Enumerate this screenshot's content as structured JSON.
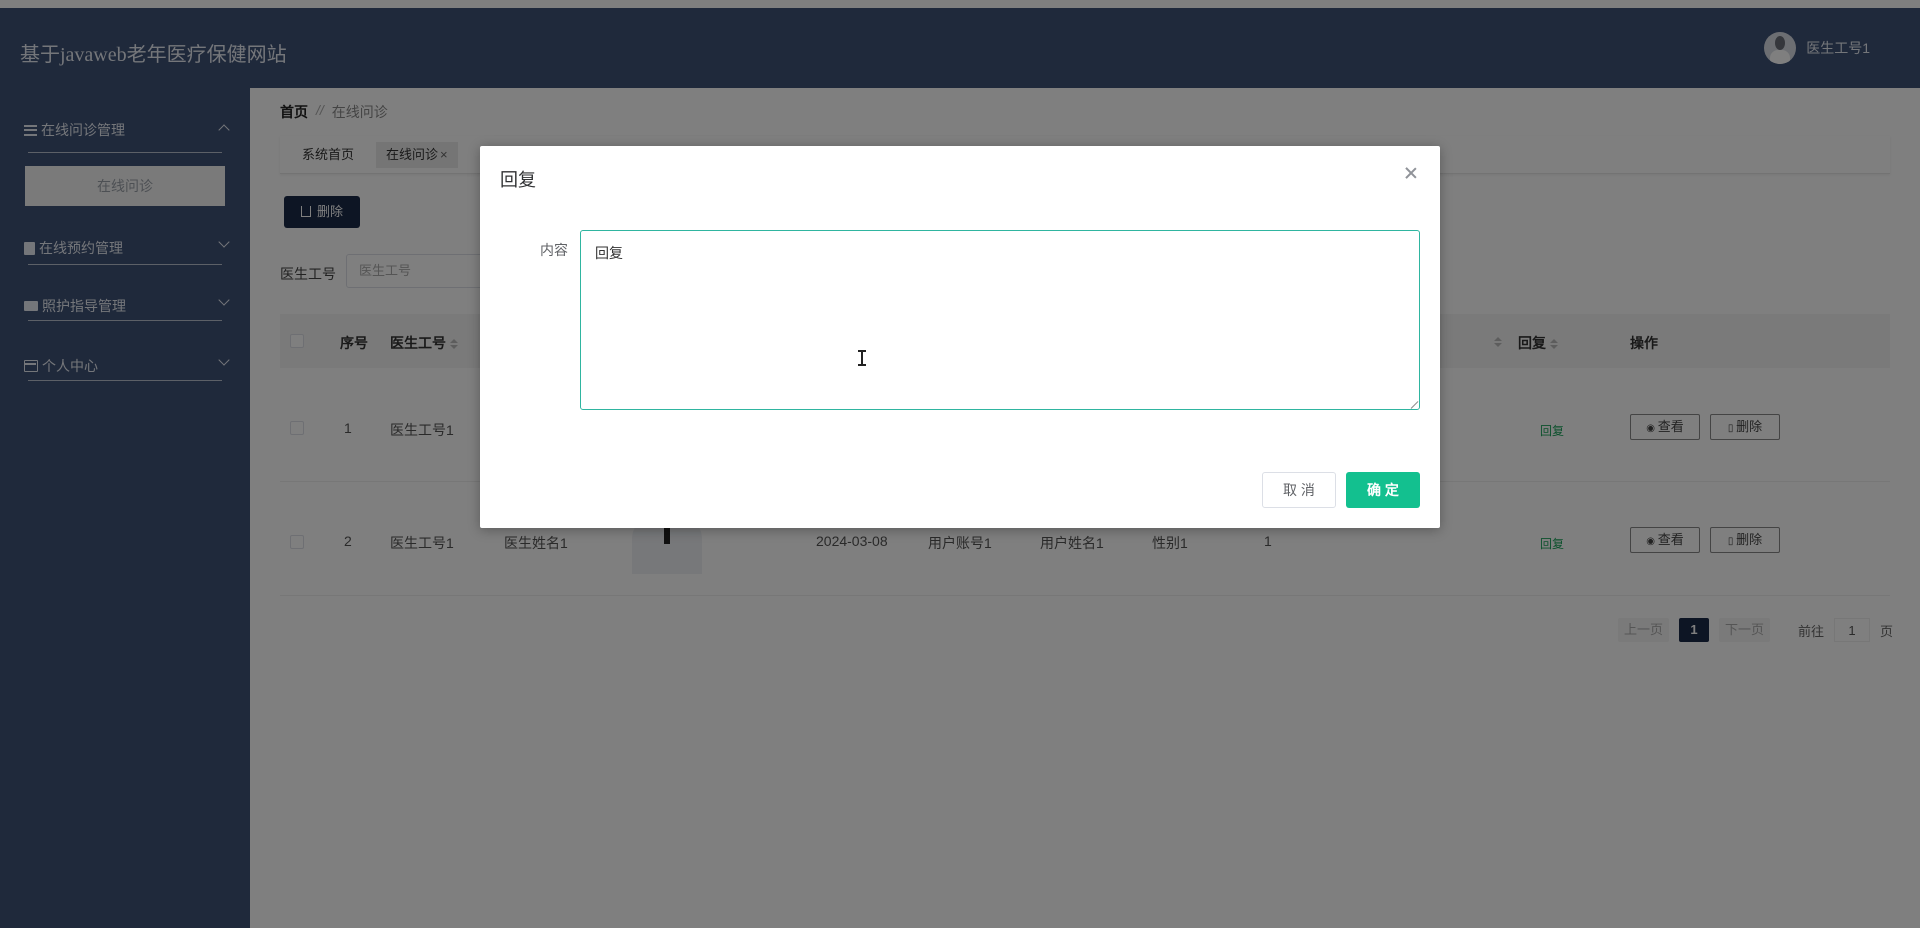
{
  "header": {
    "site_title": "基于javaweb老年医疗保健网站",
    "user_name": "医生工号1"
  },
  "sidebar": {
    "groups": [
      {
        "label": "在线问诊管理",
        "icon": "list-icon",
        "expanded": true,
        "items": [
          {
            "label": "在线问诊"
          }
        ]
      },
      {
        "label": "在线预约管理",
        "icon": "clipboard-icon",
        "expanded": false
      },
      {
        "label": "照护指导管理",
        "icon": "monitor-icon",
        "expanded": false
      },
      {
        "label": "个人中心",
        "icon": "card-icon",
        "expanded": false
      }
    ]
  },
  "breadcrumb": {
    "home": "首页",
    "separator": "//",
    "current": "在线问诊"
  },
  "tabs": [
    {
      "label": "系统首页",
      "active": false
    },
    {
      "label": "在线问诊",
      "active": true,
      "close": "×"
    }
  ],
  "toolbar": {
    "delete_label": "删除",
    "delete_icon": "trash-icon"
  },
  "search": {
    "label": "医生工号",
    "placeholder": "医生工号"
  },
  "table": {
    "headers": {
      "index": "序号",
      "doctor_id": "医生工号",
      "reply": "回复",
      "actions": "操作"
    },
    "rows": [
      {
        "index": "1",
        "doctor_id": "医生工号1",
        "reply": "回复",
        "view": "查看",
        "delete": "删除"
      },
      {
        "index": "2",
        "doctor_id": "医生工号1",
        "doctor_name": "医生姓名1",
        "date": "2024-03-08",
        "user_account": "用户账号1",
        "user_name": "用户姓名1",
        "gender": "性别1",
        "number": "1",
        "reply": "回复",
        "view": "查看",
        "delete": "删除"
      }
    ]
  },
  "pagination": {
    "prev": "上一页",
    "current": "1",
    "next": "下一页",
    "goto_prefix": "前往",
    "goto_value": "1",
    "goto_suffix": "页"
  },
  "dialog": {
    "title": "回复",
    "content_label": "内容",
    "content_value": "回复",
    "cancel_label": "取 消",
    "confirm_label": "确 定"
  },
  "colors": {
    "header_bg": "#3f5276",
    "primary_dark": "#1b2a48",
    "confirm": "#13c08f",
    "reply_text": "#1aa35a"
  }
}
